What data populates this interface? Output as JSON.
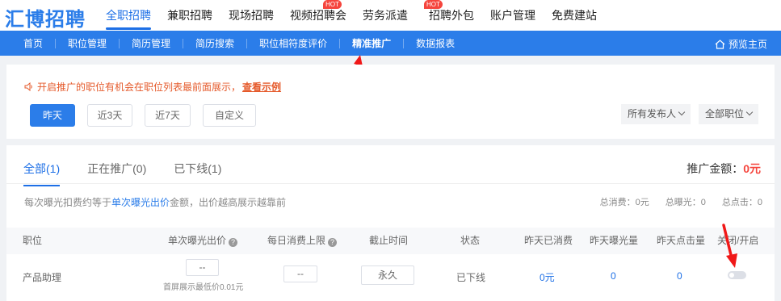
{
  "logo": "汇博招聘",
  "main_nav": [
    {
      "label": "全职招聘",
      "active": true,
      "hot": false
    },
    {
      "label": "兼职招聘",
      "active": false,
      "hot": false
    },
    {
      "label": "现场招聘",
      "active": false,
      "hot": false
    },
    {
      "label": "视频招聘会",
      "active": false,
      "hot": true
    },
    {
      "label": "劳务派遣",
      "active": false,
      "hot": false
    },
    {
      "label": "招聘外包",
      "active": false,
      "hot": true
    },
    {
      "label": "账户管理",
      "active": false,
      "hot": false
    },
    {
      "label": "免费建站",
      "active": false,
      "hot": false
    }
  ],
  "hot_label": "HOT",
  "sub_nav": [
    {
      "label": "首页",
      "active": false
    },
    {
      "label": "职位管理",
      "active": false
    },
    {
      "label": "简历管理",
      "active": false
    },
    {
      "label": "简历搜索",
      "active": false
    },
    {
      "label": "职位相符度评价",
      "active": false
    },
    {
      "label": "精准推广",
      "active": true
    },
    {
      "label": "数据报表",
      "active": false
    }
  ],
  "preview_home": "预览主页",
  "tip": {
    "text": "开启推广的职位有机会在职位列表最前面展示，",
    "link": "查看示例"
  },
  "date_filters": [
    {
      "label": "昨天",
      "active": true
    },
    {
      "label": "近3天",
      "active": false
    },
    {
      "label": "近7天",
      "active": false
    },
    {
      "label": "自定义",
      "active": false
    }
  ],
  "filters": {
    "publisher": "所有发布人",
    "position": "全部职位"
  },
  "tabs": [
    {
      "label": "全部(1)",
      "active": true
    },
    {
      "label": "正在推广(0)",
      "active": false
    },
    {
      "label": "已下线(1)",
      "active": false
    }
  ],
  "amount": {
    "label": "推广金额：",
    "value": "0元"
  },
  "note": {
    "pre": "每次曝光扣费约等于",
    "highlight": "单次曝光出价",
    "post": "金额，出价越高展示越靠前"
  },
  "stats": {
    "total_spend": "总消费：0元",
    "total_exposure": "总曝光：0",
    "total_clicks": "总点击：0"
  },
  "table": {
    "headers": [
      "职位",
      "单次曝光出价",
      "每日消费上限",
      "截止时间",
      "状态",
      "昨天已消费",
      "昨天曝光量",
      "昨天点击量",
      "关闭/开启"
    ],
    "rows": [
      {
        "position": "产品助理",
        "bid": "--",
        "min_bid_note": "首屏展示最低价0.01元",
        "daily_cap": "--",
        "deadline": "永久",
        "status": "已下线",
        "spent_yesterday": "0元",
        "exposure_yesterday": "0",
        "clicks_yesterday": "0",
        "enabled": false
      }
    ]
  },
  "colors": {
    "brand": "#2b7de9",
    "accent_red": "#f5453d",
    "tip_orange": "#e55a2b"
  }
}
